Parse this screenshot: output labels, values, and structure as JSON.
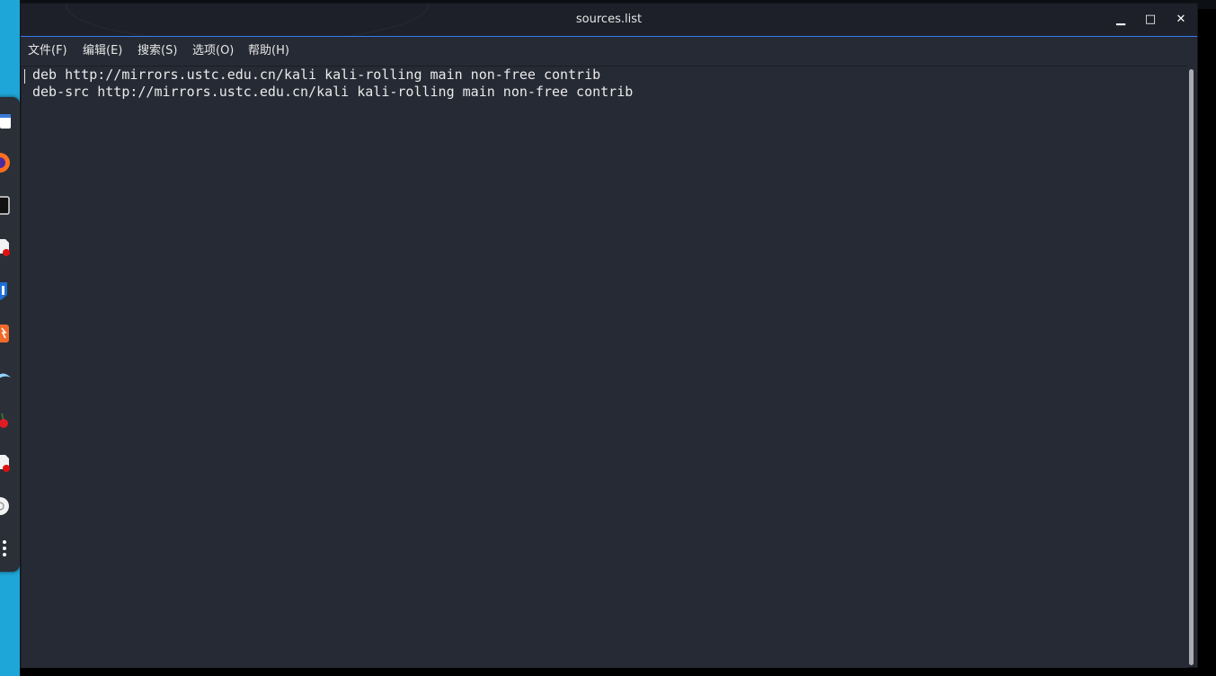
{
  "window": {
    "title": "sources.list",
    "minimize_symbol": "▁",
    "maximize_symbol": "□",
    "close_symbol": "✕"
  },
  "menubar": {
    "items": [
      {
        "label": "文件(F)"
      },
      {
        "label": "编辑(E)"
      },
      {
        "label": "搜索(S)"
      },
      {
        "label": "选项(O)"
      },
      {
        "label": "帮助(H)"
      }
    ]
  },
  "editor": {
    "lines": [
      "deb http://mirrors.ustc.edu.cn/kali kali-rolling main non-free contrib",
      "deb-src http://mirrors.ustc.edu.cn/kali kali-rolling main non-free contrib"
    ]
  },
  "dock": {
    "icons": [
      "file-manager-icon",
      "firefox-icon",
      "terminal-icon",
      "text-editor-icon",
      "metasploit-icon",
      "burpsuite-icon",
      "wireshark-icon",
      "cherrytree-icon",
      "text-editor-2-icon",
      "disk-icon",
      "app-grid-icon"
    ]
  },
  "colors": {
    "accent": "#367bf0",
    "desktop": "#1fa6d8",
    "window_bg": "#262a34",
    "titlebar_bg": "#1d2028"
  }
}
